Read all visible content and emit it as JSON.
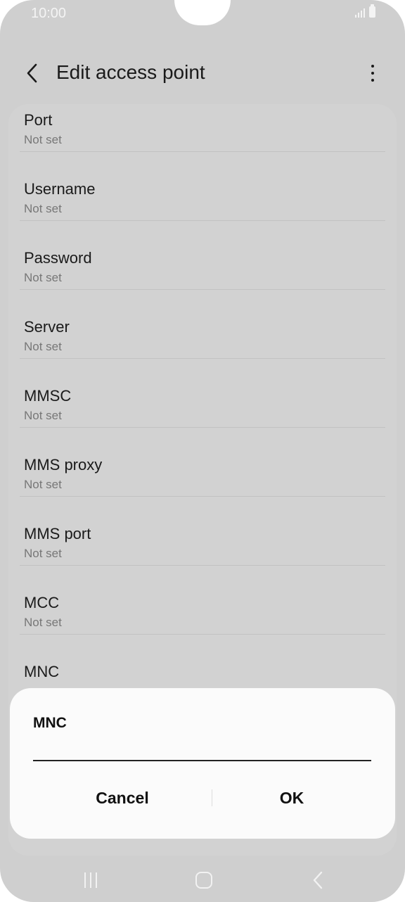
{
  "status_bar": {
    "time": "10:00"
  },
  "header": {
    "title": "Edit access point"
  },
  "settings": [
    {
      "label": "Port",
      "value": "Not set"
    },
    {
      "label": "Username",
      "value": "Not set"
    },
    {
      "label": "Password",
      "value": "Not set"
    },
    {
      "label": "Server",
      "value": "Not set"
    },
    {
      "label": "MMSC",
      "value": "Not set"
    },
    {
      "label": "MMS proxy",
      "value": "Not set"
    },
    {
      "label": "MMS port",
      "value": "Not set"
    },
    {
      "label": "MCC",
      "value": "Not set"
    },
    {
      "label": "MNC",
      "value": ""
    }
  ],
  "dialog": {
    "title": "MNC",
    "input_value": "",
    "cancel_label": "Cancel",
    "ok_label": "OK"
  },
  "icons": {
    "back": "chevron-left-icon",
    "more": "more-vertical-icon",
    "recents": "recent-apps-icon",
    "home": "home-icon",
    "nav_back": "nav-back-icon"
  },
  "colors": {
    "background": "#cfcfcf",
    "dialog": "#fbfbfb",
    "text": "#1a1a1a",
    "secondary_text": "#777777"
  }
}
